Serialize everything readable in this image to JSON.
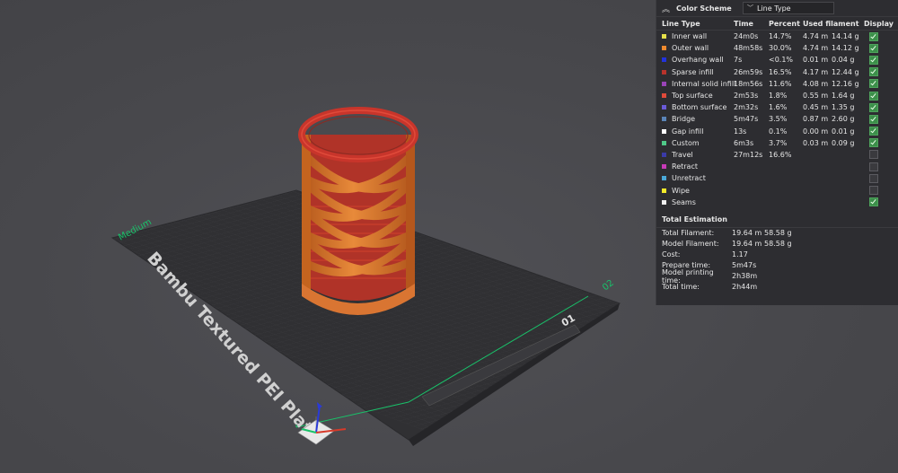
{
  "plate": {
    "name": "Bambu Textured PEI Plate",
    "plate_number": "01",
    "mode_label": "Medium",
    "edge_label": "02"
  },
  "panel": {
    "title": "Color Scheme",
    "selected_scheme": "Line Type",
    "columns": {
      "line_type": "Line Type",
      "time": "Time",
      "percent": "Percent",
      "used_filament": "Used filament",
      "display": "Display"
    },
    "rows": [
      {
        "name": "Inner wall",
        "color": "#e6e04a",
        "time": "24m0s",
        "percent": "14.7%",
        "fil_m": "4.74 m",
        "fil_g": "14.14 g",
        "display": true
      },
      {
        "name": "Outer wall",
        "color": "#f08a2e",
        "time": "48m58s",
        "percent": "30.0%",
        "fil_m": "4.74 m",
        "fil_g": "14.12 g",
        "display": true
      },
      {
        "name": "Overhang wall",
        "color": "#2233dd",
        "time": "7s",
        "percent": "<0.1%",
        "fil_m": "0.01 m",
        "fil_g": "0.04 g",
        "display": true
      },
      {
        "name": "Sparse infill",
        "color": "#b8332b",
        "time": "26m59s",
        "percent": "16.5%",
        "fil_m": "4.17 m",
        "fil_g": "12.44 g",
        "display": true
      },
      {
        "name": "Internal solid infill",
        "color": "#9a44b8",
        "time": "18m56s",
        "percent": "11.6%",
        "fil_m": "4.08 m",
        "fil_g": "12.16 g",
        "display": true
      },
      {
        "name": "Top surface",
        "color": "#e04a3a",
        "time": "2m53s",
        "percent": "1.8%",
        "fil_m": "0.55 m",
        "fil_g": "1.64 g",
        "display": true
      },
      {
        "name": "Bottom surface",
        "color": "#6a5ad8",
        "time": "2m32s",
        "percent": "1.6%",
        "fil_m": "0.45 m",
        "fil_g": "1.35 g",
        "display": true
      },
      {
        "name": "Bridge",
        "color": "#5a84b8",
        "time": "5m47s",
        "percent": "3.5%",
        "fil_m": "0.87 m",
        "fil_g": "2.60 g",
        "display": true
      },
      {
        "name": "Gap infill",
        "color": "#ffffff",
        "time": "13s",
        "percent": "0.1%",
        "fil_m": "0.00 m",
        "fil_g": "0.01 g",
        "display": true
      },
      {
        "name": "Custom",
        "color": "#4fc888",
        "time": "6m3s",
        "percent": "3.7%",
        "fil_m": "0.03 m",
        "fil_g": "0.09 g",
        "display": true
      },
      {
        "name": "Travel",
        "color": "#3a3aa8",
        "time": "27m12s",
        "percent": "16.6%",
        "fil_m": "",
        "fil_g": "",
        "display": false
      },
      {
        "name": "Retract",
        "color": "#c83ab8",
        "time": "",
        "percent": "",
        "fil_m": "",
        "fil_g": "",
        "display": false
      },
      {
        "name": "Unretract",
        "color": "#4aa8d8",
        "time": "",
        "percent": "",
        "fil_m": "",
        "fil_g": "",
        "display": false
      },
      {
        "name": "Wipe",
        "color": "#f2ea2a",
        "time": "",
        "percent": "",
        "fil_m": "",
        "fil_g": "",
        "display": false
      },
      {
        "name": "Seams",
        "color": "#f0f0f0",
        "time": "",
        "percent": "",
        "fil_m": "",
        "fil_g": "",
        "display": true
      }
    ],
    "estimation": {
      "title": "Total Estimation",
      "items": [
        {
          "label": "Total Filament:",
          "v1": "19.64 m",
          "v2": "58.58 g"
        },
        {
          "label": "Model Filament:",
          "v1": "19.64 m",
          "v2": "58.58 g"
        },
        {
          "label": "Cost:",
          "v1": "1.17",
          "v2": ""
        },
        {
          "label": "Prepare time:",
          "v1": "5m47s",
          "v2": ""
        },
        {
          "label": "Model printing time:",
          "v1": "2h38m",
          "v2": ""
        },
        {
          "label": "Total time:",
          "v1": "2h44m",
          "v2": ""
        }
      ]
    }
  },
  "colors": {
    "viewport_bg": "#4a4a4e",
    "plate": "#303033",
    "model_orange": "#e07a2e",
    "model_red": "#c8352b",
    "accent_green": "#19c26a",
    "panel_bg": "#2d2d31"
  }
}
